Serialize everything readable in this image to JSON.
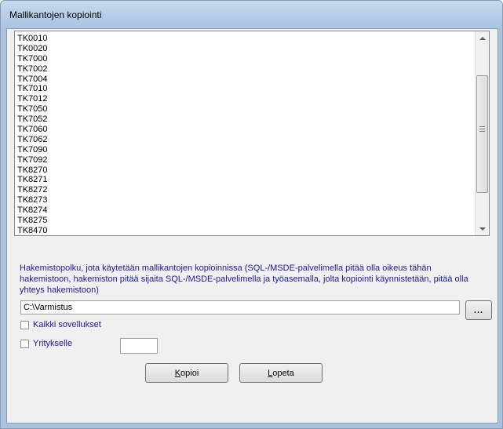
{
  "window": {
    "title": "Mallikantojen kopiointi"
  },
  "list": {
    "items": [
      "TK0010",
      "TK0020",
      "TK7000",
      "TK7002",
      "TK7004",
      "TK7010",
      "TK7012",
      "TK7050",
      "TK7052",
      "TK7060",
      "TK7062",
      "TK7090",
      "TK7092",
      "TK8270",
      "TK8271",
      "TK8272",
      "TK8273",
      "TK8274",
      "TK8275",
      "TK8470"
    ]
  },
  "info": {
    "text": "Hakemistopolku, jota käytetään mallikantojen kopioinnissa (SQL-/MSDE-palvelimella pitää olla oikeus tähän hakemistoon, hakemiston pitää sijaita SQL-/MSDE-palvelimella ja työasemalla, jolta kopiointi käynnistetään, pitää olla yhteys hakemistoon)"
  },
  "path": {
    "value": "C:\\Varmistus"
  },
  "browse": {
    "label": "..."
  },
  "options": {
    "all_apps": "Kaikki sovellukset",
    "company": "Yritykselle"
  },
  "buttons": {
    "copy_first": "K",
    "copy_rest": "opioi",
    "quit_first": "L",
    "quit_rest": "opeta"
  }
}
